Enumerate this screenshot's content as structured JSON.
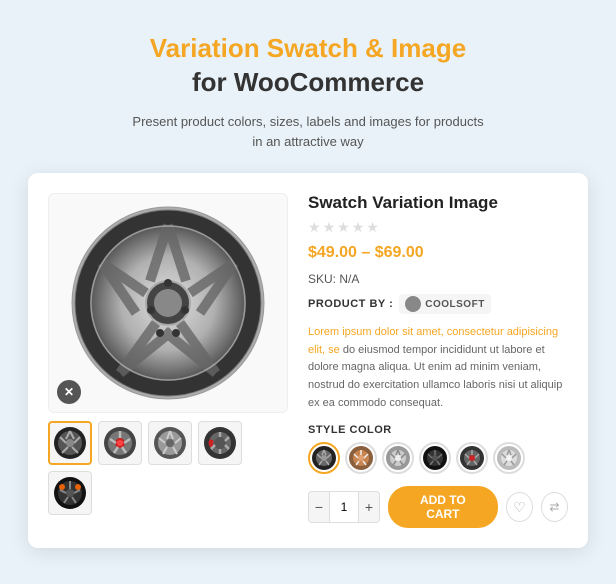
{
  "header": {
    "title_line1": "Variation Swatch & Image",
    "title_line2": "for WooCommerce",
    "subtitle": "Present product colors, sizes, labels and images for products\nin an attractive way"
  },
  "product": {
    "title": "Swatch Variation Image",
    "price": "$49.00 – $69.00",
    "sku_label": "SKU:",
    "sku_value": "N/A",
    "product_by_label": "PRODUCT BY :",
    "brand_name": "COOLSOFT",
    "description": "Lorem ipsum dolor sit amet, consectetur adipisicing elit, sed do eiusmod tempor incididunt ut labore et dolore magna aliqua. Ut enim ad minim veniam, nostrud do exercitation ullamco laboris nisi ut aliquip ex ea commodo consequat.",
    "style_color_label": "STYLE COLOR",
    "add_to_cart_label": "Add To Cart",
    "qty_default": "1",
    "qty_minus": "−",
    "qty_plus": "+"
  },
  "swatches": [
    {
      "id": 1,
      "color": "#555555",
      "active": true
    },
    {
      "id": 2,
      "color": "#cc7722",
      "active": false
    },
    {
      "id": 3,
      "color": "#aaaaaa",
      "active": false
    },
    {
      "id": 4,
      "color": "#333333",
      "active": false
    },
    {
      "id": 5,
      "color": "#cc2222",
      "active": false
    },
    {
      "id": 6,
      "color": "#cccccc",
      "active": false
    }
  ],
  "icons": {
    "star": "★",
    "remove": "✕",
    "heart": "♡",
    "compare": "⇄",
    "minus": "−",
    "plus": "+"
  }
}
